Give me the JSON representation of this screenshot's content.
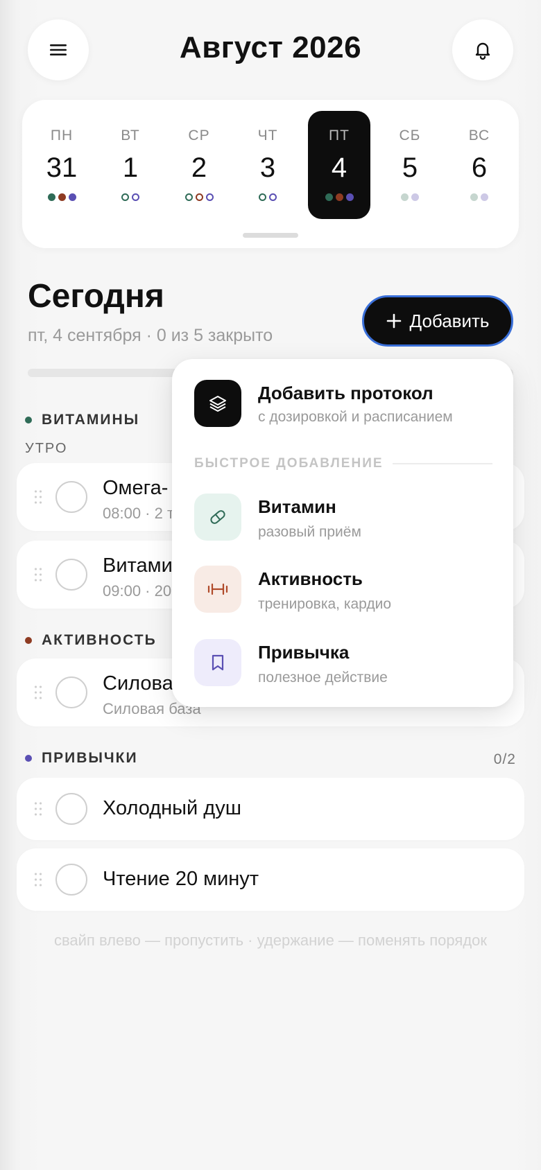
{
  "header": {
    "title": "Август 2026",
    "menu_icon": "hamburger-menu-icon",
    "notification_icon": "bell-icon"
  },
  "week": {
    "days": [
      {
        "name": "ПН",
        "date": "31"
      },
      {
        "name": "ВТ",
        "date": "1"
      },
      {
        "name": "СР",
        "date": "2"
      },
      {
        "name": "ЧТ",
        "date": "3"
      },
      {
        "name": "ПТ",
        "date": "4"
      },
      {
        "name": "СБ",
        "date": "5"
      },
      {
        "name": "ВС",
        "date": "6"
      }
    ],
    "selected": "ПТ"
  },
  "today": {
    "title": "Сегодня",
    "subtitle": "пт, 4 сентября · 0 из 5 закрыто",
    "add_label": "Добавить"
  },
  "sections": {
    "vitamins": {
      "label": "ВИТАМИНЫ",
      "subgroup": "УТРО"
    },
    "activity": {
      "label": "АКТИВНОСТЬ"
    },
    "habits": {
      "label": "ПРИВЫЧКИ",
      "count": "0/2"
    }
  },
  "items": {
    "omega": {
      "title": "Омега-",
      "sub": "08:00 · 2 т"
    },
    "vitamin": {
      "title": "Витами",
      "sub": "09:00 · 20"
    },
    "strength": {
      "title": "Силова",
      "sub": "Силовая база"
    },
    "shower": {
      "title": "Холодный душ"
    },
    "reading": {
      "title": "Чтение 20 минут"
    }
  },
  "hint": "свайп влево — пропустить · удержание — поменять порядок",
  "menu": {
    "protocol": {
      "title": "Добавить протокол",
      "sub": "с дозировкой и расписанием"
    },
    "quick_label": "БЫСТРОЕ ДОБАВЛЕНИЕ",
    "vitamin": {
      "title": "Витамин",
      "sub": "разовый приём"
    },
    "activity": {
      "title": "Активность",
      "sub": "тренировка, кардио"
    },
    "habit": {
      "title": "Привычка",
      "sub": "полезное действие"
    }
  },
  "colors": {
    "vitamins": "#2f6b57",
    "activity": "#8e3b22",
    "habits": "#5a4fb3",
    "accent_border": "#3a6fd8"
  }
}
